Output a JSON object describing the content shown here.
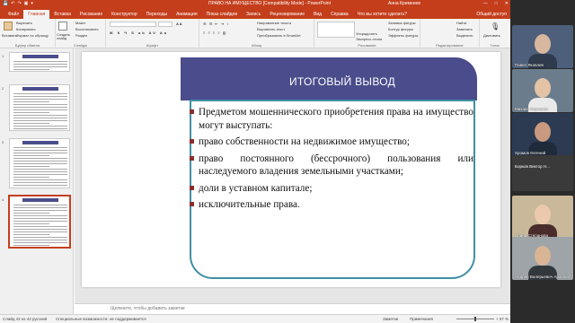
{
  "titlebar": {
    "qat": [
      "💾",
      "↶",
      "↷",
      "▣",
      "▾"
    ],
    "title": "ПРАВО НА ИМУЩЕСТВО [Compatibility Mode] - PowerPoint",
    "user": "Анна Кременев",
    "controls": [
      "—",
      "□",
      "✕"
    ]
  },
  "tabs": [
    {
      "label": "Файл",
      "active": false
    },
    {
      "label": "Главная",
      "active": true
    },
    {
      "label": "Вставка",
      "active": false
    },
    {
      "label": "Рисование",
      "active": false
    },
    {
      "label": "Конструктор",
      "active": false
    },
    {
      "label": "Переходы",
      "active": false
    },
    {
      "label": "Анимация",
      "active": false
    },
    {
      "label": "Показ слайдов",
      "active": false
    },
    {
      "label": "Запись",
      "active": false
    },
    {
      "label": "Рецензирование",
      "active": false
    },
    {
      "label": "Вид",
      "active": false
    },
    {
      "label": "Справка",
      "active": false
    },
    {
      "label": "Что вы хотите сделать?",
      "active": false
    }
  ],
  "share_label": "Общий доступ",
  "ribbon": {
    "clipboard": {
      "paste": "Вставить",
      "cut": "Вырезать",
      "copy": "Копировать",
      "format": "Формат по образцу",
      "group": "Буфер обмена"
    },
    "slides": {
      "new_slide": "Создать слайд",
      "layout": "Макет",
      "reset": "Восстановить",
      "section": "Раздел",
      "group": "Слайды"
    },
    "font": {
      "group": "Шрифт"
    },
    "paragraph": {
      "group": "Абзац",
      "text_direction": "Направление текста",
      "align_text": "Выровнять текст",
      "smartart": "Преобразовать в SmartArt"
    },
    "drawing": {
      "group": "Рисование",
      "arrange": "Упорядочить",
      "quick_styles": "Экспресс-стили",
      "fill": "Заливка фигуры",
      "outline": "Контур фигуры",
      "effects": "Эффекты фигуры"
    },
    "editing": {
      "group": "Редактирование",
      "find": "Найти",
      "replace": "Заменить",
      "select": "Выделить"
    },
    "voice": {
      "dictate": "Диктовать",
      "group": "Голос"
    }
  },
  "thumbnails": [
    {
      "num": "1",
      "title": "Право на имущество",
      "selected": false
    },
    {
      "num": "2",
      "title": "Право на имущество",
      "selected": false
    },
    {
      "num": "3",
      "title": "Право на имущество",
      "selected": false
    },
    {
      "num": "4",
      "title": "Итоговый вывод",
      "selected": true
    }
  ],
  "slide": {
    "title": "ИТОГОВЫЙ ВЫВОД",
    "bullets": [
      "Предметом мошеннического приобретения права на имущество могут выступать:",
      "право собственности на недвижимое имущество;",
      "право постоянного (бессрочного) пользования или наследуемого владения земельными участками;",
      "доли в уставном капитале;",
      "исключительные права."
    ]
  },
  "notes_placeholder": "Щелкните, чтобы добавить заметки",
  "status": {
    "slide_count": "Слайд 42 из 42",
    "language": "русский",
    "accessibility": "Специальные возможности: не поддерживается",
    "notes": "Заметки",
    "comments": "Примечания",
    "zoom": "+ 57 %"
  },
  "participants": [
    {
      "name": "Павел Яковлев",
      "type": "video",
      "bg": "#4d5f7a",
      "face": "#d8b79f",
      "shirt": "#2f3a4c"
    },
    {
      "name": "Михаил Кирюшин",
      "type": "video",
      "bg": "#6b7d8c",
      "face": "#e3c2a5",
      "shirt": "#e9e9e9"
    },
    {
      "name": "Хромов Евгений",
      "type": "video",
      "bg": "#2d3b52",
      "face": "#c99a80",
      "shirt": "#1f2a3b"
    },
    {
      "name": "Борков Виктор Н...",
      "type": "name"
    },
    {
      "name": "Ирина Степанова",
      "type": "video",
      "bg": "#c9b89a",
      "face": "#ecc9ac",
      "shirt": "#4a2c2a"
    },
    {
      "name": "Андрей Валерьевич Архипов",
      "type": "video",
      "bg": "#9ea4a8",
      "face": "#d9b596",
      "shirt": "#33383f"
    }
  ]
}
